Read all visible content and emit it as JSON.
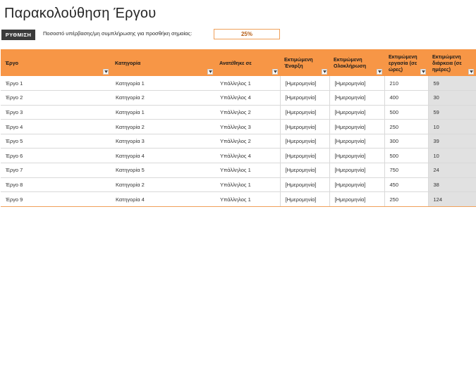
{
  "title": "Παρακολούθηση Έργου",
  "setup_button": "ΡΥΘΜΙΣΗ",
  "flag_label": "Ποσοστό υπέρβασης/μη συμπλήρωσης για προσθήκη σημαίας:",
  "flag_value": "25%",
  "colors": {
    "header": "#f79646",
    "duration_bg": "#e1e1e1",
    "button": "#3b3b3b"
  },
  "headers": {
    "project": "Έργο",
    "category": "Κατηγορία",
    "assigned": "Ανατέθηκε σε",
    "start": "Εκτιμώμενη Έναρξη",
    "end": "Εκτιμώμενη Ολοκλήρωση",
    "hours": "Εκτιμώμενη εργασία (σε ώρες)",
    "days": "Εκτιμώμενη διάρκεια (σε ημέρες)"
  },
  "rows": [
    {
      "project": "Έργο 1",
      "category": "Κατηγορία 1",
      "assigned": "Υπάλληλος 1",
      "start": "[Ημερομηνία]",
      "end": "[Ημερομηνία]",
      "hours": "210",
      "days": "59"
    },
    {
      "project": "Έργο 2",
      "category": "Κατηγορία 2",
      "assigned": "Υπάλληλος 4",
      "start": "[Ημερομηνία]",
      "end": "[Ημερομηνία]",
      "hours": "400",
      "days": "30"
    },
    {
      "project": "Έργο 3",
      "category": "Κατηγορία 1",
      "assigned": "Υπάλληλος 2",
      "start": "[Ημερομηνία]",
      "end": "[Ημερομηνία]",
      "hours": "500",
      "days": "59"
    },
    {
      "project": "Έργο 4",
      "category": "Κατηγορία 2",
      "assigned": "Υπάλληλος 3",
      "start": "[Ημερομηνία]",
      "end": "[Ημερομηνία]",
      "hours": "250",
      "days": "10"
    },
    {
      "project": "Έργο 5",
      "category": "Κατηγορία 3",
      "assigned": "Υπάλληλος 2",
      "start": "[Ημερομηνία]",
      "end": "[Ημερομηνία]",
      "hours": "300",
      "days": "39"
    },
    {
      "project": "Έργο 6",
      "category": "Κατηγορία 4",
      "assigned": "Υπάλληλος 4",
      "start": "[Ημερομηνία]",
      "end": "[Ημερομηνία]",
      "hours": "500",
      "days": "10"
    },
    {
      "project": "Έργο 7",
      "category": "Κατηγορία 5",
      "assigned": "Υπάλληλος 1",
      "start": "[Ημερομηνία]",
      "end": "[Ημερομηνία]",
      "hours": "750",
      "days": "24"
    },
    {
      "project": "Έργο 8",
      "category": "Κατηγορία 2",
      "assigned": "Υπάλληλος 1",
      "start": "[Ημερομηνία]",
      "end": "[Ημερομηνία]",
      "hours": "450",
      "days": "38"
    },
    {
      "project": "Έργο 9",
      "category": "Κατηγορία 4",
      "assigned": "Υπάλληλος 1",
      "start": "[Ημερομηνία]",
      "end": "[Ημερομηνία]",
      "hours": "250",
      "days": "124"
    }
  ]
}
